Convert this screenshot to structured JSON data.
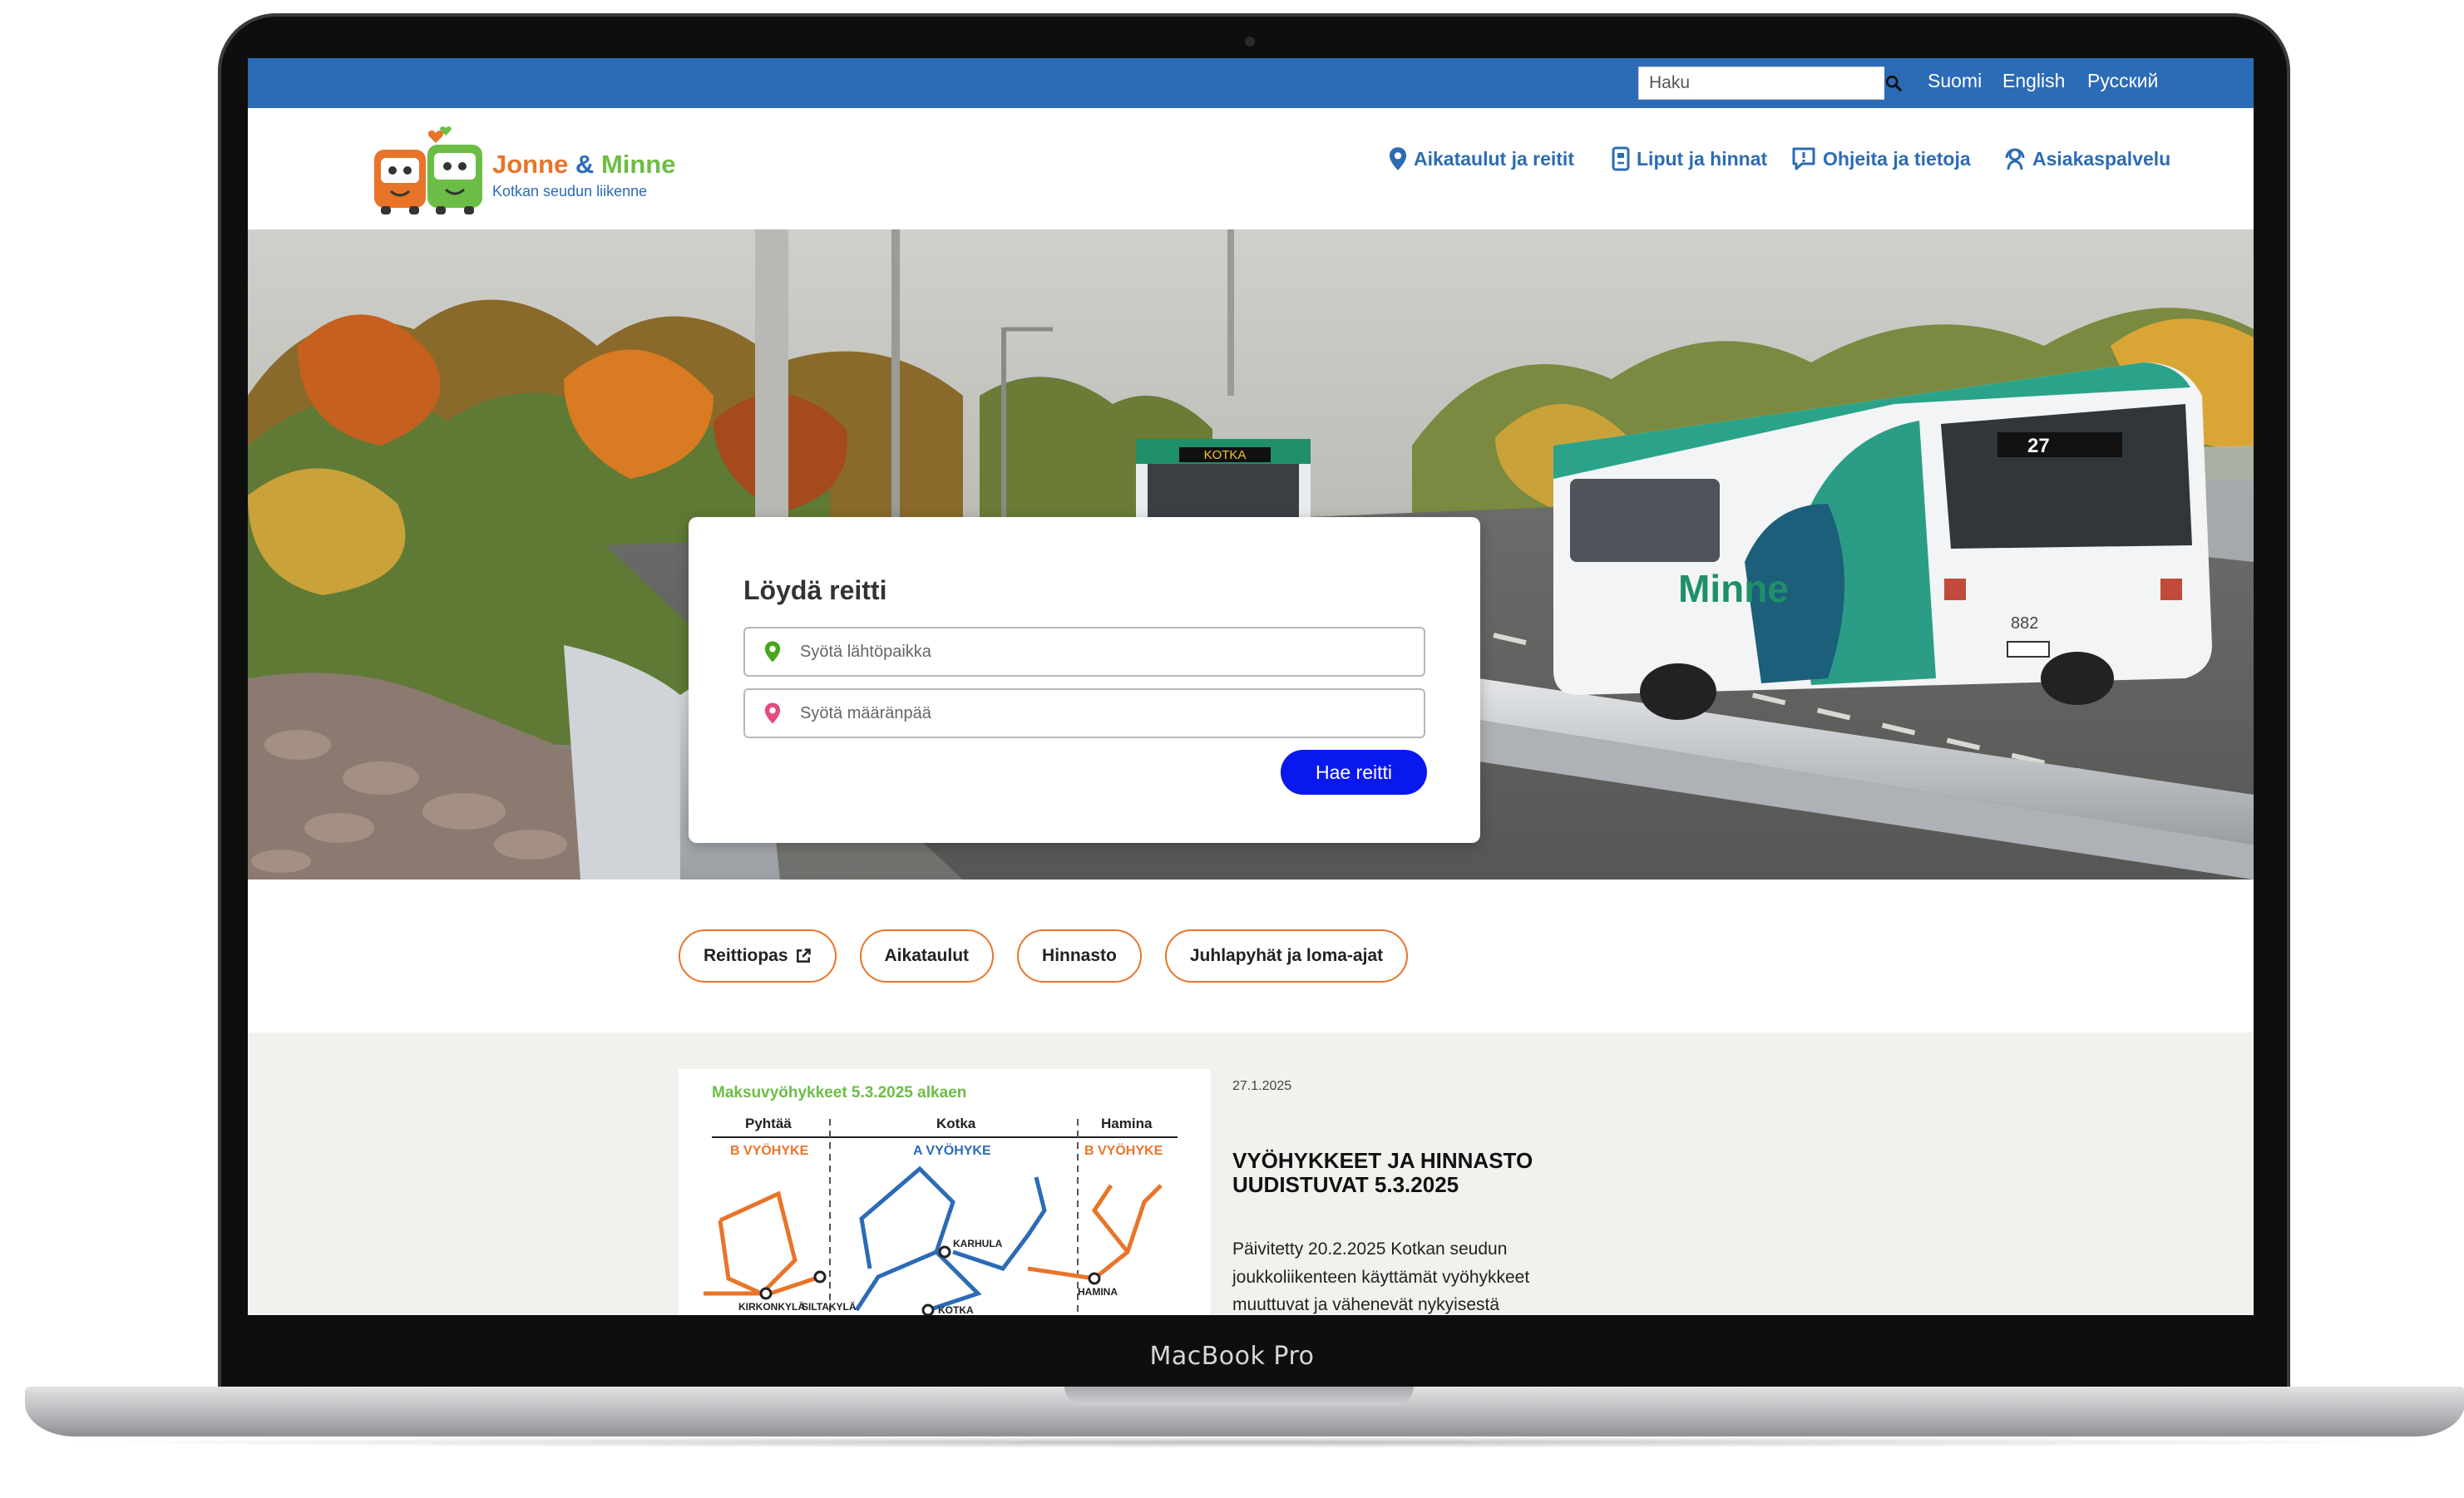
{
  "device": {
    "label": "MacBook Pro"
  },
  "topbar": {
    "search_placeholder": "Haku",
    "languages": [
      "Suomi",
      "English",
      "Русский"
    ]
  },
  "brand": {
    "name_part1": "Jonne",
    "name_amp": "&",
    "name_part2": "Minne",
    "subtitle": "Kotkan seudun liikenne"
  },
  "nav": {
    "items": [
      {
        "label": "Aikataulut ja reitit",
        "icon": "map-pin-icon"
      },
      {
        "label": "Liput ja hinnat",
        "icon": "ticket-card-icon"
      },
      {
        "label": "Ohjeita ja tietoja",
        "icon": "info-bubble-icon"
      },
      {
        "label": "Asiakaspalvelu",
        "icon": "headset-icon"
      }
    ]
  },
  "hero": {
    "bus_front_sign": "KOTKA",
    "bus_number": "27",
    "bus_side_text": "Minne",
    "bus_fleet_number": "882"
  },
  "route_finder": {
    "title": "Löydä reitti",
    "from_placeholder": "Syötä lähtöpaikka",
    "to_placeholder": "Syötä määränpää",
    "button": "Hae reitti"
  },
  "quick_links": [
    {
      "label": "Reittiopas",
      "external": true
    },
    {
      "label": "Aikataulut",
      "external": false
    },
    {
      "label": "Hinnasto",
      "external": false
    },
    {
      "label": "Juhlapyhät ja loma-ajat",
      "external": false
    }
  ],
  "news": {
    "image": {
      "title": "Maksuvyöhykkeet 5.3.2025 alkaen",
      "columns": [
        "Pyhtää",
        "Kotka",
        "Hamina"
      ],
      "zones": [
        "B VYÖHYKE",
        "A VYÖHYKE",
        "B VYÖHYKE"
      ],
      "stops": [
        "KIRKONKYLÄ",
        "SILTAKYLÄ",
        "KARHULA",
        "HAMINA",
        "KOTKA"
      ]
    },
    "date": "27.1.2025",
    "title": "Vyöhykkeet ja hinnasto uudistuvat 5.3.2025",
    "excerpt": "Päivitetty 20.2.2025 Kotkan seudun joukkoliikenteen käyttämät vyöhykkeet muuttuvat ja vähenevät nykyisestä"
  },
  "colors": {
    "brand_blue": "#2c6bb5",
    "brand_orange": "#e8742a",
    "brand_green": "#6cbd45",
    "cta_blue": "#0a18f0",
    "pin_green": "#4aa51c",
    "pin_pink": "#e64a7b"
  }
}
